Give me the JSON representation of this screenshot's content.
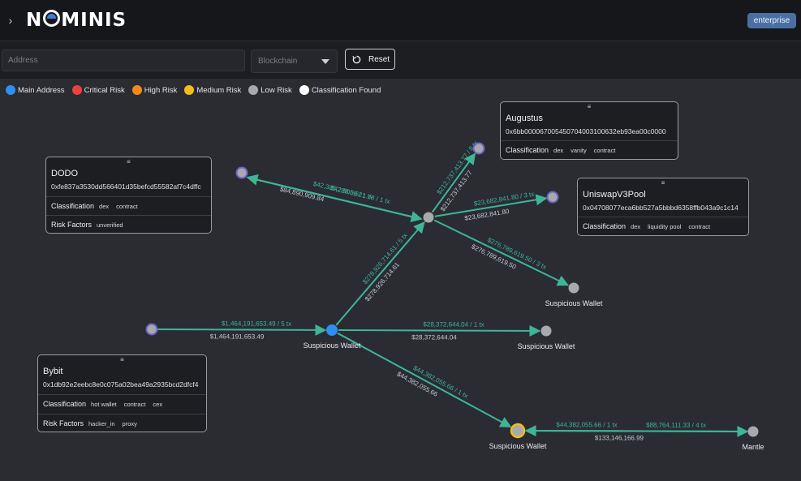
{
  "header": {
    "sidebar_toggle": "›",
    "logo": {
      "before": "N",
      "after": "MINIS"
    },
    "plan_badge": "enterprise"
  },
  "toolbar": {
    "address_placeholder": "Address",
    "blockchain_placeholder": "Blockchain",
    "reset_label": "Reset"
  },
  "legend": [
    {
      "label": "Main Address",
      "color": "#2f8ff0"
    },
    {
      "label": "Critical Risk",
      "color": "#e8433f"
    },
    {
      "label": "High Risk",
      "color": "#f08a1c"
    },
    {
      "label": "Medium Risk",
      "color": "#f5bd1c"
    },
    {
      "label": "Low Risk",
      "color": "#a8a9ad"
    },
    {
      "label": "Classification Found",
      "color": "#ffffff"
    }
  ],
  "graph": {
    "colors": {
      "edge": "#3fb598",
      "node_low": "#a8a9ad",
      "node_main": "#2f8ff0",
      "node_classified_ring": "#6b63c8",
      "node_medium_ring": "#f5bd1c"
    },
    "nodes": [
      {
        "id": "source",
        "label": ""
      },
      {
        "id": "main",
        "label": "Suspicious Wallet"
      },
      {
        "id": "hub",
        "label": ""
      },
      {
        "id": "dodo",
        "label": ""
      },
      {
        "id": "augustus",
        "label": ""
      },
      {
        "id": "uniswap",
        "label": ""
      },
      {
        "id": "sw_right",
        "label": "Suspicious Wallet"
      },
      {
        "id": "sw_mid",
        "label": "Suspicious Wallet"
      },
      {
        "id": "sw_bottom",
        "label": "Suspicious Wallet"
      },
      {
        "id": "mantle",
        "label": "Mantle"
      }
    ],
    "edges": [
      {
        "from": "source",
        "to": "main",
        "top_label": "$1,464,191,653.49 / 5 tx",
        "bottom_label": "$1,464,191,653.49"
      },
      {
        "from": "main",
        "to": "hub",
        "top_label": "$278,926,714.61 / 5 tx",
        "bottom_label": "$278,926,714.61"
      },
      {
        "from": "main",
        "to": "sw_mid",
        "top_label": "$28,372,644.04 / 1 tx",
        "bottom_label": "$28,372,644.04"
      },
      {
        "from": "main",
        "to": "sw_bottom",
        "top_label": "$44,382,055.66 / 1 tx",
        "bottom_label": "$44,382,055.66"
      },
      {
        "from": "hub",
        "to": "dodo",
        "top_label": "$42,505,621.78 / 1 tx",
        "bottom_label": ""
      },
      {
        "from": "dodo",
        "to": "hub",
        "top_label": "$42,385,288.06 / 1 tx",
        "bottom_label": "$84,890,909.84"
      },
      {
        "from": "hub",
        "to": "augustus",
        "top_label": "$212,737,413.77 / 8 tx",
        "bottom_label": "$212,737,413.77"
      },
      {
        "from": "hub",
        "to": "uniswap",
        "top_label": "$23,682,841.80 / 3 tx",
        "bottom_label": "$23,682,841.80"
      },
      {
        "from": "hub",
        "to": "sw_right",
        "top_label": "$276,789,619.50 / 3 tx",
        "bottom_label": "$276,789,619.50"
      },
      {
        "from": "sw_bottom",
        "to": "mantle",
        "top_label": "$88,764,111.33 / 4 tx",
        "bottom_label": "$133,146,166.99"
      },
      {
        "from": "mantle",
        "to": "sw_bottom",
        "top_label": "$44,382,055.66 / 1 tx",
        "bottom_label": ""
      }
    ]
  },
  "cards": {
    "dodo": {
      "handle": "≡",
      "title": "DODO",
      "address": "0xfe837a3530dd566401d35befcd55582af7c4dffc",
      "classification_label": "Classification",
      "classification_tags": [
        "dex",
        "contract"
      ],
      "risk_label": "Risk Factors",
      "risk_tags": [
        "unverified"
      ]
    },
    "augustus": {
      "handle": "≡",
      "title": "Augustus",
      "address": "0x6bb000067005450704003100632eb93ea00c0000",
      "classification_label": "Classification",
      "classification_tags": [
        "dex",
        "vanity",
        "contract"
      ]
    },
    "uniswap": {
      "handle": "≡",
      "title": "UniswapV3Pool",
      "address": "0x04708077eca6bb527a5bbbd6358ffb043a9c1c14",
      "classification_label": "Classification",
      "classification_tags": [
        "dex",
        "liquidity pool",
        "contract"
      ]
    },
    "bybit": {
      "handle": "≡",
      "title": "Bybit",
      "address": "0x1db92e2eebc8e0c075a02bea49a2935bcd2dfcf4",
      "classification_label": "Classification",
      "classification_tags": [
        "hot wallet",
        "contract",
        "cex"
      ],
      "risk_label": "Risk Factors",
      "risk_tags": [
        "hacker_in",
        "proxy"
      ]
    }
  }
}
